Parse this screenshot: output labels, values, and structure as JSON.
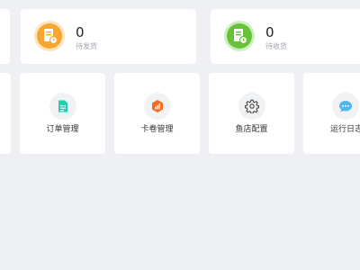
{
  "stats": [
    {
      "value": "0",
      "label": "待发货",
      "icon": "pending-ship-icon",
      "color": "#f8a631"
    },
    {
      "value": "0",
      "label": "待收货",
      "icon": "pending-receive-icon",
      "color": "#67c23a"
    }
  ],
  "tiles": [
    {
      "label": "订单管理",
      "icon": "order-icon",
      "color": "#1fcfb2"
    },
    {
      "label": "卡卷管理",
      "icon": "coupon-icon",
      "color": "#f56a1e"
    },
    {
      "label": "鱼店配置",
      "icon": "gear-icon",
      "color": "#444444"
    },
    {
      "label": "运行日志",
      "icon": "chat-log-icon",
      "color": "#4fb8ee"
    }
  ]
}
